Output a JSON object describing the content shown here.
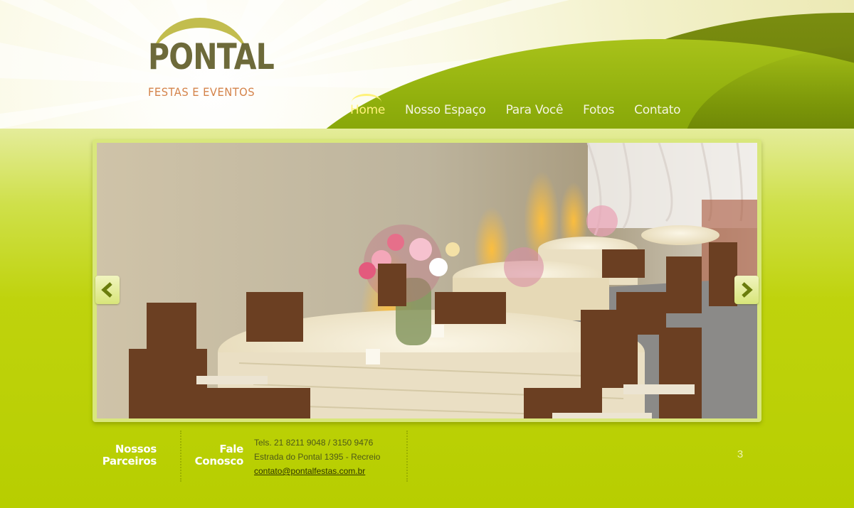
{
  "logo": {
    "name": "PONTAL",
    "subtitle": "FESTAS E EVENTOS"
  },
  "nav": {
    "items": [
      {
        "label": "Home",
        "active": true
      },
      {
        "label": "Nosso Espaço",
        "active": false
      },
      {
        "label": "Para Você",
        "active": false
      },
      {
        "label": "Fotos",
        "active": false
      },
      {
        "label": "Contato",
        "active": false
      }
    ]
  },
  "slider": {
    "prev_icon": "chevron-left-icon",
    "next_icon": "chevron-right-icon",
    "current_slide": "3"
  },
  "footer": {
    "parceiros_line1": "Nossos",
    "parceiros_line2": "Parceiros",
    "fale_line1": "Fale",
    "fale_line2": "Conosco",
    "phones": "Tels. 21 8211 9048 / 3150 9476",
    "address": "Estrada do Pontal 1395 - Recreio",
    "email": "contato@pontalfestas.com.br"
  },
  "colors": {
    "accent": "#b8cf00",
    "nav_active": "#fff27a",
    "logo_text": "#6d6a3a",
    "logo_sub": "#d4834a"
  }
}
